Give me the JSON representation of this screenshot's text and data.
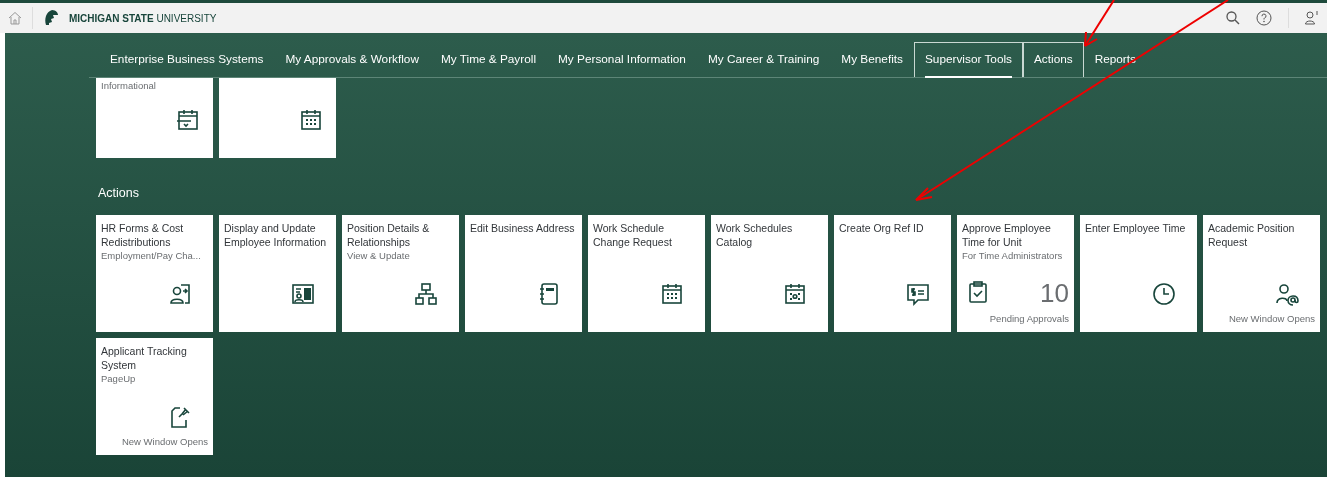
{
  "header": {
    "logo_text": "**MICHIGAN STATE** UNIVERSITY"
  },
  "nav": [
    {
      "label": "Enterprise Business Systems",
      "selected": false,
      "outlined": false
    },
    {
      "label": "My Approvals & Workflow",
      "selected": false,
      "outlined": false
    },
    {
      "label": "My Time & Payroll",
      "selected": false,
      "outlined": false
    },
    {
      "label": "My Personal Information",
      "selected": false,
      "outlined": false
    },
    {
      "label": "My Career & Training",
      "selected": false,
      "outlined": false
    },
    {
      "label": "My Benefits",
      "selected": false,
      "outlined": false
    },
    {
      "label": "Supervisor Tools",
      "selected": true,
      "outlined": true
    },
    {
      "label": "Actions",
      "selected": false,
      "outlined": true
    },
    {
      "label": "Reports",
      "selected": false,
      "outlined": false
    }
  ],
  "partial_tiles": [
    {
      "kind": "subtitled",
      "subtitle": "Informational"
    },
    {
      "kind": "blank"
    }
  ],
  "sections": [
    {
      "title": "Actions",
      "tiles": [
        {
          "kind": "launch",
          "title": "HR Forms & Cost Redistributions",
          "subtitle": "Employment/Pay Cha..."
        },
        {
          "kind": "launch",
          "title": "Display and Update Employee Information"
        },
        {
          "kind": "launch",
          "title": "Position Details & Relationships",
          "subtitle": "View & Update"
        },
        {
          "kind": "launch",
          "title": "Edit Business Address"
        },
        {
          "kind": "launch",
          "title": "Work Schedule Change Request"
        },
        {
          "kind": "launch",
          "title": "Work Schedules Catalog"
        },
        {
          "kind": "launch",
          "title": "Create Org Ref ID"
        },
        {
          "kind": "kpi",
          "title": "Approve Employee Time for Unit",
          "subtitle": "For Time Administrators",
          "number": "10",
          "footer": "Pending Approvals"
        },
        {
          "kind": "launch",
          "title": "Enter Employee Time"
        },
        {
          "kind": "launch",
          "title": "Academic Position Request",
          "footer": "New Window Opens"
        },
        {
          "kind": "launch",
          "title": "Applicant Tracking System",
          "subtitle": "PageUp",
          "footer": "New Window Opens"
        }
      ]
    }
  ]
}
